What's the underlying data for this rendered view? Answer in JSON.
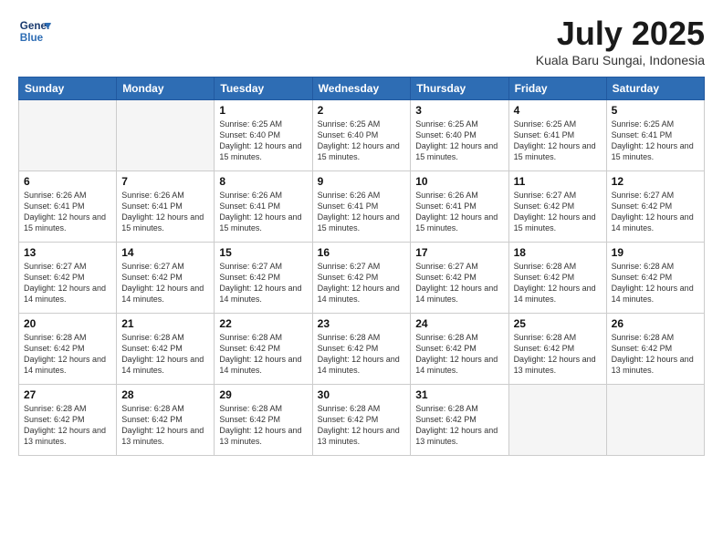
{
  "logo": {
    "line1": "General",
    "line2": "Blue"
  },
  "title": "July 2025",
  "location": "Kuala Baru Sungai, Indonesia",
  "days_of_week": [
    "Sunday",
    "Monday",
    "Tuesday",
    "Wednesday",
    "Thursday",
    "Friday",
    "Saturday"
  ],
  "weeks": [
    [
      {
        "day": "",
        "info": ""
      },
      {
        "day": "",
        "info": ""
      },
      {
        "day": "1",
        "info": "Sunrise: 6:25 AM\nSunset: 6:40 PM\nDaylight: 12 hours and 15 minutes."
      },
      {
        "day": "2",
        "info": "Sunrise: 6:25 AM\nSunset: 6:40 PM\nDaylight: 12 hours and 15 minutes."
      },
      {
        "day": "3",
        "info": "Sunrise: 6:25 AM\nSunset: 6:40 PM\nDaylight: 12 hours and 15 minutes."
      },
      {
        "day": "4",
        "info": "Sunrise: 6:25 AM\nSunset: 6:41 PM\nDaylight: 12 hours and 15 minutes."
      },
      {
        "day": "5",
        "info": "Sunrise: 6:25 AM\nSunset: 6:41 PM\nDaylight: 12 hours and 15 minutes."
      }
    ],
    [
      {
        "day": "6",
        "info": "Sunrise: 6:26 AM\nSunset: 6:41 PM\nDaylight: 12 hours and 15 minutes."
      },
      {
        "day": "7",
        "info": "Sunrise: 6:26 AM\nSunset: 6:41 PM\nDaylight: 12 hours and 15 minutes."
      },
      {
        "day": "8",
        "info": "Sunrise: 6:26 AM\nSunset: 6:41 PM\nDaylight: 12 hours and 15 minutes."
      },
      {
        "day": "9",
        "info": "Sunrise: 6:26 AM\nSunset: 6:41 PM\nDaylight: 12 hours and 15 minutes."
      },
      {
        "day": "10",
        "info": "Sunrise: 6:26 AM\nSunset: 6:41 PM\nDaylight: 12 hours and 15 minutes."
      },
      {
        "day": "11",
        "info": "Sunrise: 6:27 AM\nSunset: 6:42 PM\nDaylight: 12 hours and 15 minutes."
      },
      {
        "day": "12",
        "info": "Sunrise: 6:27 AM\nSunset: 6:42 PM\nDaylight: 12 hours and 14 minutes."
      }
    ],
    [
      {
        "day": "13",
        "info": "Sunrise: 6:27 AM\nSunset: 6:42 PM\nDaylight: 12 hours and 14 minutes."
      },
      {
        "day": "14",
        "info": "Sunrise: 6:27 AM\nSunset: 6:42 PM\nDaylight: 12 hours and 14 minutes."
      },
      {
        "day": "15",
        "info": "Sunrise: 6:27 AM\nSunset: 6:42 PM\nDaylight: 12 hours and 14 minutes."
      },
      {
        "day": "16",
        "info": "Sunrise: 6:27 AM\nSunset: 6:42 PM\nDaylight: 12 hours and 14 minutes."
      },
      {
        "day": "17",
        "info": "Sunrise: 6:27 AM\nSunset: 6:42 PM\nDaylight: 12 hours and 14 minutes."
      },
      {
        "day": "18",
        "info": "Sunrise: 6:28 AM\nSunset: 6:42 PM\nDaylight: 12 hours and 14 minutes."
      },
      {
        "day": "19",
        "info": "Sunrise: 6:28 AM\nSunset: 6:42 PM\nDaylight: 12 hours and 14 minutes."
      }
    ],
    [
      {
        "day": "20",
        "info": "Sunrise: 6:28 AM\nSunset: 6:42 PM\nDaylight: 12 hours and 14 minutes."
      },
      {
        "day": "21",
        "info": "Sunrise: 6:28 AM\nSunset: 6:42 PM\nDaylight: 12 hours and 14 minutes."
      },
      {
        "day": "22",
        "info": "Sunrise: 6:28 AM\nSunset: 6:42 PM\nDaylight: 12 hours and 14 minutes."
      },
      {
        "day": "23",
        "info": "Sunrise: 6:28 AM\nSunset: 6:42 PM\nDaylight: 12 hours and 14 minutes."
      },
      {
        "day": "24",
        "info": "Sunrise: 6:28 AM\nSunset: 6:42 PM\nDaylight: 12 hours and 14 minutes."
      },
      {
        "day": "25",
        "info": "Sunrise: 6:28 AM\nSunset: 6:42 PM\nDaylight: 12 hours and 13 minutes."
      },
      {
        "day": "26",
        "info": "Sunrise: 6:28 AM\nSunset: 6:42 PM\nDaylight: 12 hours and 13 minutes."
      }
    ],
    [
      {
        "day": "27",
        "info": "Sunrise: 6:28 AM\nSunset: 6:42 PM\nDaylight: 12 hours and 13 minutes."
      },
      {
        "day": "28",
        "info": "Sunrise: 6:28 AM\nSunset: 6:42 PM\nDaylight: 12 hours and 13 minutes."
      },
      {
        "day": "29",
        "info": "Sunrise: 6:28 AM\nSunset: 6:42 PM\nDaylight: 12 hours and 13 minutes."
      },
      {
        "day": "30",
        "info": "Sunrise: 6:28 AM\nSunset: 6:42 PM\nDaylight: 12 hours and 13 minutes."
      },
      {
        "day": "31",
        "info": "Sunrise: 6:28 AM\nSunset: 6:42 PM\nDaylight: 12 hours and 13 minutes."
      },
      {
        "day": "",
        "info": ""
      },
      {
        "day": "",
        "info": ""
      }
    ]
  ]
}
